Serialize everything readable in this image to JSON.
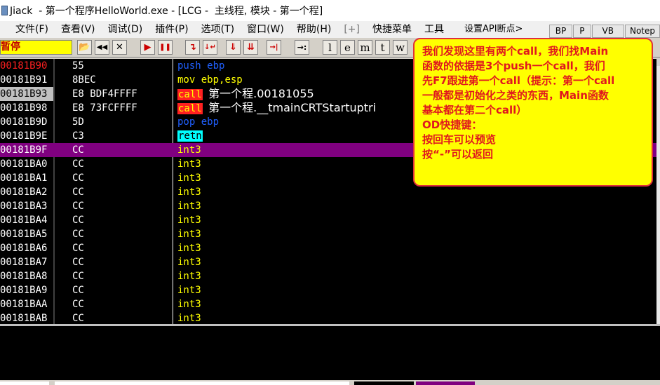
{
  "window": {
    "title": "Jiack  - 第一个程序HelloWorld.exe - [LCG -  主线程, 模块 - 第一个程]"
  },
  "menu": {
    "items": [
      "文件(F)",
      "查看(V)",
      "调试(D)",
      "插件(P)",
      "选项(T)",
      "窗口(W)",
      "帮助(H)",
      "[+]",
      "快捷菜单",
      "工具",
      "设置API断点>"
    ],
    "tabs": [
      "BP",
      "P",
      "VB",
      "Notep"
    ]
  },
  "toolbar": {
    "status": "暂停",
    "buttons": [
      "📂",
      "◀◀",
      "✕",
      "▶",
      "❚❚",
      "↴",
      "↓↵",
      "⇓",
      "⇊",
      "→|",
      "→:",
      "l",
      "e",
      "m",
      "t",
      "w"
    ]
  },
  "disasm": {
    "rows": [
      {
        "addr": "00181B90",
        "hex": "55",
        "mnem": "push",
        "ops": "ebp",
        "cls": "m-push",
        "eip": true
      },
      {
        "addr": "00181B91",
        "hex": "8BEC",
        "mnem": "mov",
        "ops": "ebp,esp",
        "cls": "m-mov"
      },
      {
        "addr": "00181B93",
        "hex": "E8 BDF4FFFF",
        "mnem": "call",
        "ops": "第一个程.00181055",
        "cls": "m-call",
        "hl": true
      },
      {
        "addr": "00181B98",
        "hex": "E8 73FCFFFF",
        "mnem": "call",
        "ops": "第一个程.__tmainCRTStartuptri",
        "cls": "m-call"
      },
      {
        "addr": "00181B9D",
        "hex": "5D",
        "mnem": "pop",
        "ops": "ebp",
        "cls": "m-pop"
      },
      {
        "addr": "00181B9E",
        "hex": "C3",
        "mnem": "retn",
        "ops": "",
        "cls": "m-retn"
      },
      {
        "addr": "00181B9F",
        "hex": "CC",
        "mnem": "int3",
        "ops": "",
        "cls": "m-int3",
        "selected": true
      },
      {
        "addr": "00181BA0",
        "hex": "CC",
        "mnem": "int3",
        "ops": "",
        "cls": "m-int3"
      },
      {
        "addr": "00181BA1",
        "hex": "CC",
        "mnem": "int3",
        "ops": "",
        "cls": "m-int3"
      },
      {
        "addr": "00181BA2",
        "hex": "CC",
        "mnem": "int3",
        "ops": "",
        "cls": "m-int3"
      },
      {
        "addr": "00181BA3",
        "hex": "CC",
        "mnem": "int3",
        "ops": "",
        "cls": "m-int3"
      },
      {
        "addr": "00181BA4",
        "hex": "CC",
        "mnem": "int3",
        "ops": "",
        "cls": "m-int3"
      },
      {
        "addr": "00181BA5",
        "hex": "CC",
        "mnem": "int3",
        "ops": "",
        "cls": "m-int3"
      },
      {
        "addr": "00181BA6",
        "hex": "CC",
        "mnem": "int3",
        "ops": "",
        "cls": "m-int3"
      },
      {
        "addr": "00181BA7",
        "hex": "CC",
        "mnem": "int3",
        "ops": "",
        "cls": "m-int3"
      },
      {
        "addr": "00181BA8",
        "hex": "CC",
        "mnem": "int3",
        "ops": "",
        "cls": "m-int3"
      },
      {
        "addr": "00181BA9",
        "hex": "CC",
        "mnem": "int3",
        "ops": "",
        "cls": "m-int3"
      },
      {
        "addr": "00181BAA",
        "hex": "CC",
        "mnem": "int3",
        "ops": "",
        "cls": "m-int3"
      },
      {
        "addr": "00181BAB",
        "hex": "CC",
        "mnem": "int3",
        "ops": "",
        "cls": "m-int3"
      }
    ]
  },
  "callout": {
    "lines": [
      "我们发现这里有两个call，我们找Main",
      "函数的依据是3个push一个call，我们",
      "先F7跟进第一个call（提示：第一个call",
      "一般都是初始化之类的东西，Main函数",
      "基本都在第二个call）",
      "OD快捷键：",
      "按回车可以预览",
      "按“-”可以返回"
    ]
  },
  "colors": {
    "callout_bg": "#ffff00",
    "callout_text": "#e0181e",
    "selected_row": "#800080",
    "call_bg": "#ff2020"
  }
}
